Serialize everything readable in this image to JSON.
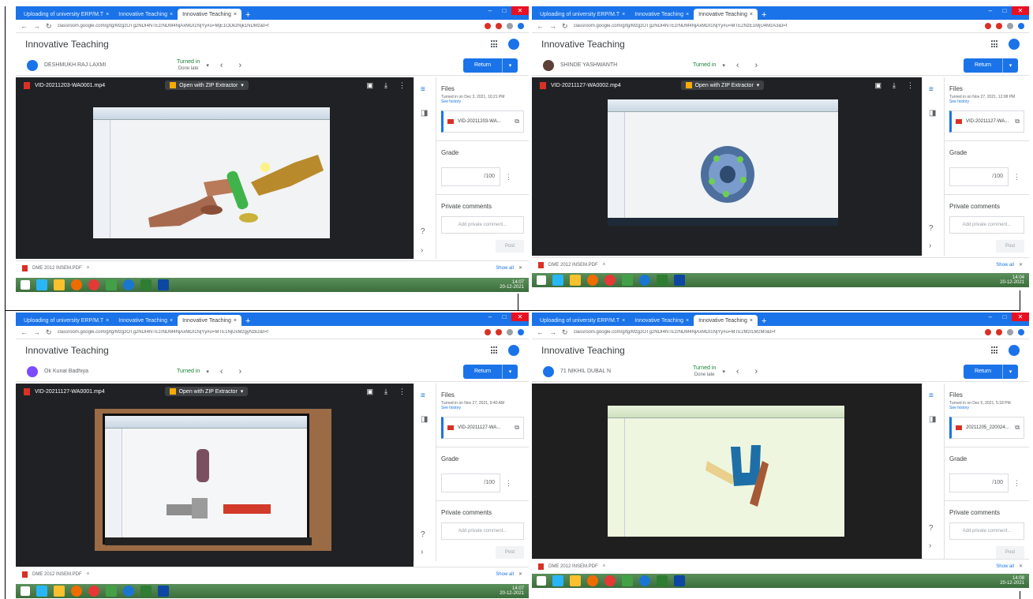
{
  "screens": [
    {
      "tab_inactive_1": "Uploading of university ERP/M.T",
      "tab_inactive_2": "Innovative Teaching",
      "tab_active": "Innovative Teaching",
      "url": "classroom.google.com/g/tg/MzgzOTg2NDI4NTEz/NDM4NjAxMDI1NjYy#u=MjE1ODkzNjk1NDMz&t=f",
      "app_title": "Innovative Teaching",
      "student": "DESHMUKH RAJ LAXMI",
      "status": "Turned in",
      "status_sub": "Done late",
      "return_label": "Return",
      "video_file": "VID-20211203-WA0001.mp4",
      "open_with": "Open with ZIP Extractor",
      "files_title": "Files",
      "files_meta": "Turned in on Dec 3, 2021, 10:21 PM",
      "see_history": "See history",
      "attachment": "VID-20211203-WA...",
      "grade_title": "Grade",
      "grade_value": "/100",
      "comments_title": "Private comments",
      "comment_placeholder": "Add private comment...",
      "post_label": "Post",
      "download_file": "DME 2012 INSEM.PDF",
      "show_all": "Show all",
      "tray_time": "14:07",
      "tray_date": "20-12-2021"
    },
    {
      "tab_inactive_1": "Uploading of university ERP/M.T",
      "tab_inactive_2": "Innovative Teaching",
      "tab_active": "Innovative Teaching",
      "url": "classroom.google.com/g/tg/MzgzOTg2NDI4NTEz/NDM4NjAxMDI1NjYy#u=MTE2NzE1MjU4MzA3&t=f",
      "app_title": "Innovative Teaching",
      "student": "SHINDE YASHWANTH",
      "status": "Turned in",
      "status_sub": "",
      "return_label": "Return",
      "video_file": "VID-20211127-WA0002.mp4",
      "open_with": "Open with ZIP Extractor",
      "files_title": "Files",
      "files_meta": "Turned in on Nov 27, 2021, 12:08 PM",
      "see_history": "See history",
      "attachment": "VID-20211127-WA...",
      "grade_title": "Grade",
      "grade_value": "/100",
      "comments_title": "Private comments",
      "comment_placeholder": "Add private comment...",
      "post_label": "Post",
      "download_file": "DME 2012 INSEM.PDF",
      "show_all": "Show all",
      "tray_time": "14:04",
      "tray_date": "20-12-2021"
    },
    {
      "tab_inactive_1": "Uploading of university ERP/M.T",
      "tab_inactive_2": "Innovative Teaching",
      "tab_active": "Innovative Teaching",
      "url": "classroom.google.com/g/tg/MzgzOTg2NDI4NTEz/NDM4NjAxMDI1NjYy#u=MTE1NjUxMzgyNzkz&t=f",
      "app_title": "Innovative Teaching",
      "student": "Ok Kunal Badhiya",
      "status": "Turned in",
      "status_sub": "",
      "return_label": "Return",
      "video_file": "VID-20211127-WA0001.mp4",
      "open_with": "Open with ZIP Extractor",
      "files_title": "Files",
      "files_meta": "Turned in on Nov 27, 2021, 9:40 AM",
      "see_history": "See history",
      "attachment": "VID-20211127-WA...",
      "grade_title": "Grade",
      "grade_value": "/100",
      "comments_title": "Private comments",
      "comment_placeholder": "Add private comment...",
      "post_label": "Post",
      "download_file": "DME 2012 INSEM.PDF",
      "show_all": "Show all",
      "tray_time": "14:07",
      "tray_date": "20-12-2021"
    },
    {
      "tab_inactive_1": "Uploading of university ERP/M.T",
      "tab_inactive_2": "Innovative Teaching",
      "tab_active": "Innovative Teaching",
      "url": "classroom.google.com/g/tg/MzgzOTg2NDI4NTEz/NDM4NjAxMDI1NjYy#u=MTE2MzI1MzM0&t=f",
      "app_title": "Innovative Teaching",
      "student": "71 NIKHIL DUBAL N",
      "status": "Turned in",
      "status_sub": "Done late",
      "return_label": "Return",
      "video_file": "",
      "open_with": "",
      "files_title": "Files",
      "files_meta": "Turned in on Dec 5, 2021, 5:18 PM",
      "see_history": "See history",
      "attachment": "20211205_220024...",
      "grade_title": "Grade",
      "grade_value": "/100",
      "comments_title": "Private comments",
      "comment_placeholder": "Add private comment...",
      "post_label": "Post",
      "download_file": "DME 2012 INSEM.PDF",
      "show_all": "Show all",
      "tray_time": "14:08",
      "tray_date": "20-12-2021"
    }
  ]
}
